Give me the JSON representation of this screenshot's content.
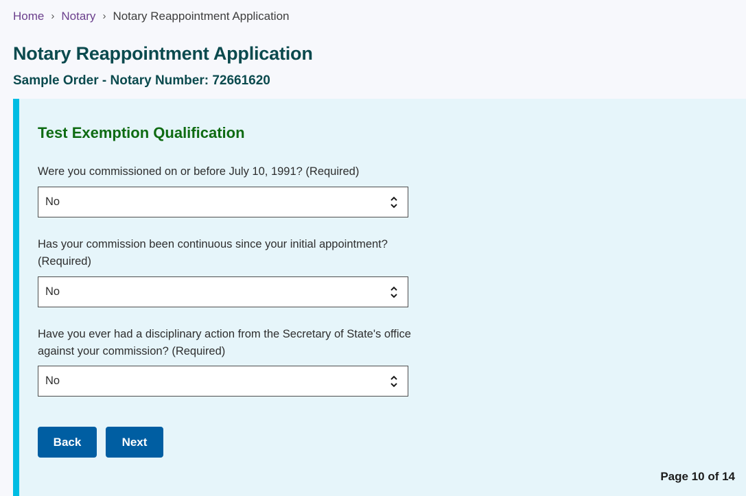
{
  "breadcrumb": {
    "items": [
      {
        "label": "Home",
        "link": true
      },
      {
        "label": "Notary",
        "link": true
      },
      {
        "label": "Notary Reappointment Application",
        "link": false
      }
    ],
    "separator_icon": "chevron-right-icon"
  },
  "header": {
    "title": "Notary Reappointment Application",
    "subtitle": "Sample Order - Notary Number: 72661620"
  },
  "form": {
    "section_title": "Test Exemption Qualification",
    "questions": [
      {
        "label": "Were you commissioned on or before July 10, 1991? (Required)",
        "value": "No"
      },
      {
        "label": "Has your commission been continuous since your initial appointment? (Required)",
        "value": "No"
      },
      {
        "label": "Have you ever had a disciplinary action from the Secretary of State's office against your commission? (Required)",
        "value": "No"
      }
    ],
    "select_icon": "up-down-chevron-icon",
    "back_label": "Back",
    "next_label": "Next"
  },
  "pagination": {
    "text": "Page 10 of 14",
    "current": 10,
    "total": 14
  },
  "colors": {
    "page_background": "#f7f8fc",
    "card_background": "#e6f5fa",
    "card_accent": "#00bde3",
    "title": "#0b4a4e",
    "section_title": "#0e6b12",
    "link": "#6b3f8c",
    "button": "#005ea2"
  }
}
